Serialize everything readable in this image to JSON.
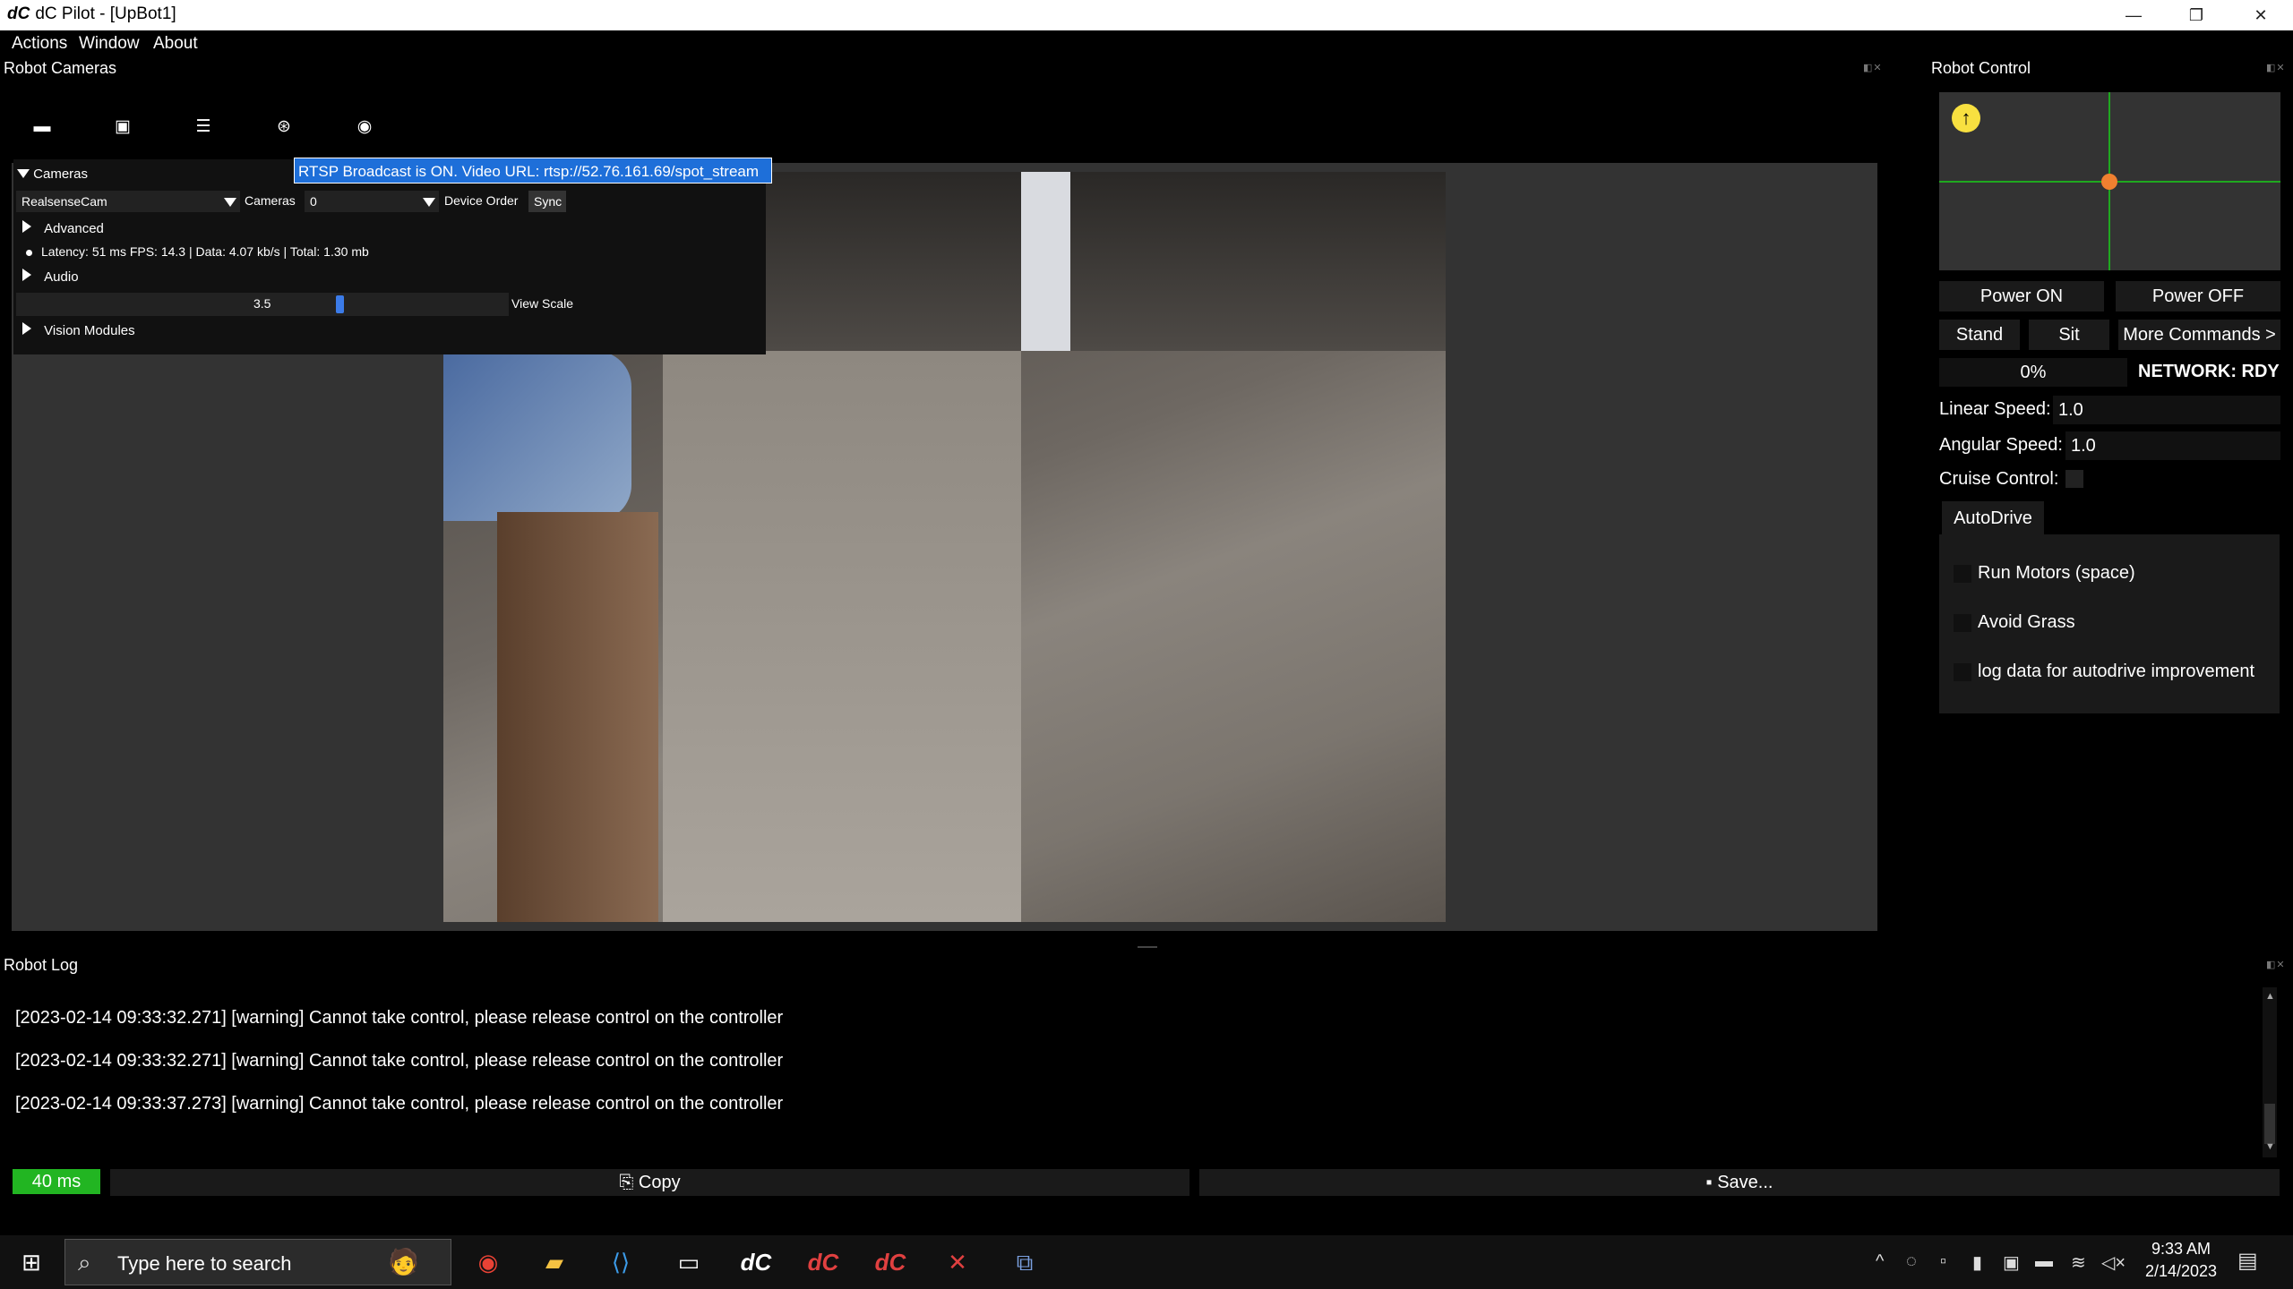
{
  "window": {
    "app_logo": "dC",
    "title": "dC Pilot - [UpBot1]",
    "minimize_glyph": "—",
    "restore_glyph": "❐",
    "close_glyph": "✕"
  },
  "menu": [
    "Actions",
    "Window",
    "About"
  ],
  "robot_cameras": {
    "title": "Robot Cameras",
    "toolbar_icons": [
      "folder-open-icon",
      "archive-icon",
      "list-icon",
      "aperture-icon",
      "camera-icon"
    ],
    "tooltip": "RTSP Broadcast is ON. Video URL: rtsp://52.76.161.69/spot_stream",
    "settings": {
      "section_cameras": "Cameras",
      "camera_select": "RealsenseCam",
      "cameras_label": "Cameras",
      "cameras_value": "0",
      "device_order_label": "Device Order",
      "sync_button": "Sync",
      "advanced": "Advanced",
      "stats": "Latency: 51 ms FPS: 14.3 | Data: 4.07 kb/s | Total: 1.30 mb",
      "audio": "Audio",
      "view_scale_value": "3.5",
      "view_scale_label": "View Scale",
      "view_scale_fraction": 0.66,
      "vision_modules": "Vision Modules"
    }
  },
  "robot_control": {
    "title": "Robot Control",
    "power_on": "Power ON",
    "power_off": "Power OFF",
    "stand": "Stand",
    "sit": "Sit",
    "more_commands": "More Commands >",
    "progress": "0%",
    "network": "NETWORK: RDY",
    "linear_speed_label": "Linear Speed:",
    "linear_speed_value": "1.0",
    "angular_speed_label": "Angular Speed:",
    "angular_speed_value": "1.0",
    "cruise_control_label": "Cruise Control:",
    "autodrive_tab": "AutoDrive",
    "options": [
      "Run Motors (space)",
      "Avoid Grass",
      "log data for autodrive improvement"
    ]
  },
  "robot_log": {
    "title": "Robot Log",
    "entries": [
      "[2023-02-14 09:33:32.271] [warning] Cannot take control, please release control on the controller",
      "[2023-02-14 09:33:32.271] [warning] Cannot take control, please release control on the controller",
      "[2023-02-14 09:33:37.273] [warning] Cannot take control, please release control on the controller"
    ],
    "latency_badge": "40 ms",
    "copy_button": "Copy",
    "save_button": "Save..."
  },
  "taskbar": {
    "search_placeholder": "Type here to search",
    "apps": [
      "chrome-icon",
      "file-explorer-icon",
      "vscode-icon",
      "terminal-icon",
      "dc-pilot-icon",
      "dc-icon-2",
      "dc-icon-3",
      "tool-icon",
      "network-tool-icon"
    ],
    "time": "9:33 AM",
    "date": "2/14/2023"
  },
  "colors": {
    "accent_blue": "#1e6fd9",
    "joystick_green": "#1fa81f",
    "joystick_dot": "#f08030",
    "latency_green": "#22b522"
  }
}
